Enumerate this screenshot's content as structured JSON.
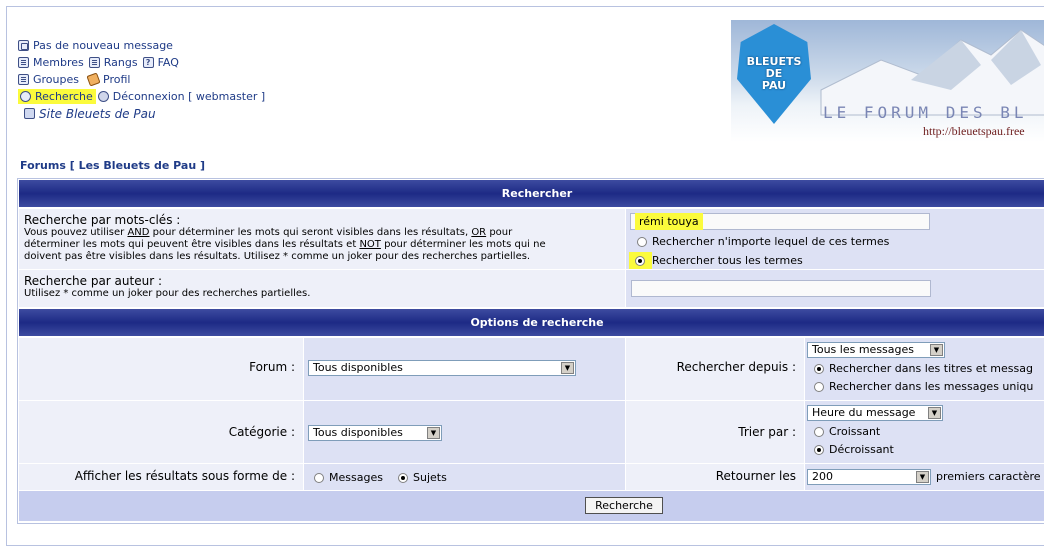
{
  "nav": {
    "no_new_messages": "Pas de nouveau message",
    "members": "Membres",
    "ranks": "Rangs",
    "faq": "FAQ",
    "groups": "Groupes",
    "profile": "Profil",
    "search": "Recherche",
    "logout": "Déconnexion [ webmaster ]",
    "site": "Site Bleuets de Pau"
  },
  "banner": {
    "crest_line1": "BLEUETS",
    "crest_line2": "DE",
    "crest_line3": "PAU",
    "title": "LE FORUM DES BL",
    "url": "http://bleuetspau.free"
  },
  "breadcrumb": "Forums [ Les Bleuets de Pau ]",
  "search": {
    "header": "Rechercher",
    "keywords_label": "Recherche par mots-clés :",
    "keywords_help_1": "Vous pouvez utiliser ",
    "keywords_help_and": "AND",
    "keywords_help_2": " pour déterminer les mots qui seront visibles dans les résultats, ",
    "keywords_help_or": "OR",
    "keywords_help_3": " pour",
    "keywords_help_4": "déterminer les mots qui peuvent être visibles dans les résultats et ",
    "keywords_help_not": "NOT",
    "keywords_help_5": " pour déterminer les mots qui ne",
    "keywords_help_6": "doivent pas être visibles dans les résultats. Utilisez * comme un joker pour des recherches partielles.",
    "keywords_value": "rémi touya",
    "any_terms": "Rechercher n'importe lequel de ces termes",
    "all_terms": "Rechercher tous les termes",
    "author_label": "Recherche par auteur :",
    "author_help": "Utilisez * comme un joker pour des recherches partielles.",
    "author_value": ""
  },
  "options": {
    "header": "Options de recherche",
    "forum_label": "Forum :",
    "forum_value": "Tous disponibles",
    "since_label": "Rechercher depuis :",
    "since_value": "Tous les messages",
    "titles_and_messages": "Rechercher dans les titres et messag",
    "messages_only": "Rechercher dans les messages uniqu",
    "category_label": "Catégorie :",
    "category_value": "Tous disponibles",
    "sort_label": "Trier par :",
    "sort_value": "Heure du message",
    "ascending": "Croissant",
    "descending": "Décroissant",
    "display_label": "Afficher les résultats sous forme de :",
    "display_messages": "Messages",
    "display_topics": "Sujets",
    "return_label": "Retourner les",
    "return_value": "200",
    "return_suffix": "premiers caractère",
    "submit": "Recherche"
  },
  "colors": {
    "header_bg": "#1d2a85",
    "highlight": "#fbfb3c",
    "link": "#1f3b87"
  }
}
